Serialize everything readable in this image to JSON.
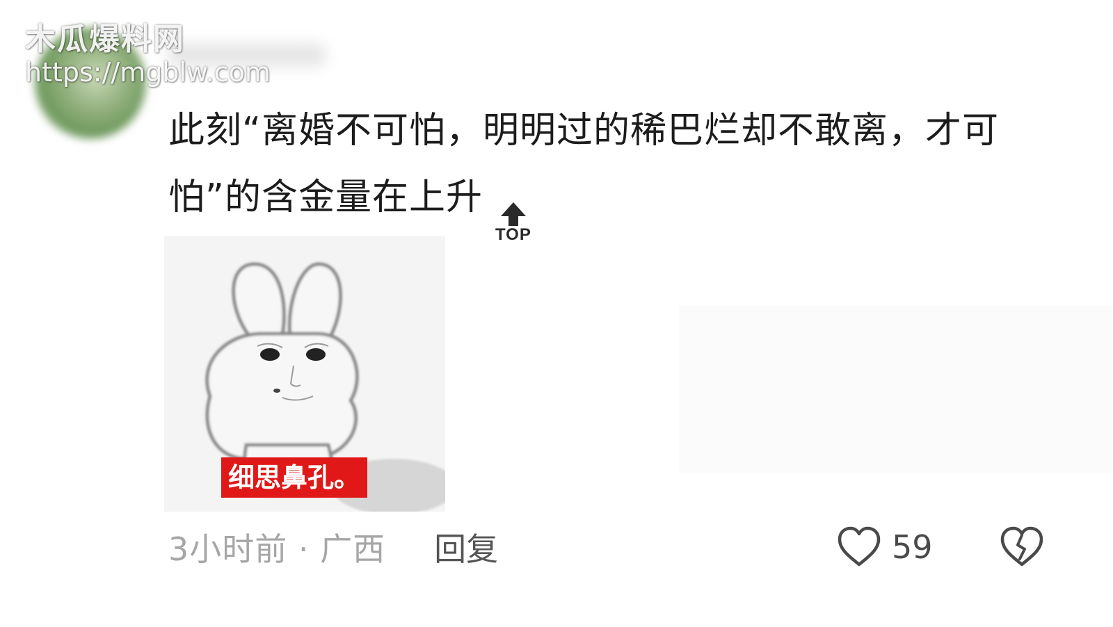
{
  "watermark": {
    "site_name": "木瓜爆料网",
    "site_url": "https://mgblw.com"
  },
  "comment": {
    "text": "此刻“离婚不可怕，明明过的稀巴烂却不敢离，才可怕”的含金量在上升",
    "badge_label": "TOP",
    "sticker_caption": "细思鼻孔。"
  },
  "footer": {
    "meta": "3小时前 · 广西",
    "reply_label": "回复",
    "like_count": "59"
  },
  "icons": {
    "like": "heart-outline-icon",
    "dislike": "broken-heart-icon",
    "badge": "up-arrow-icon"
  },
  "colors": {
    "caption_bg": "#e01818",
    "meta_text": "#a6a6a6",
    "body_text": "#1c1c1c"
  }
}
